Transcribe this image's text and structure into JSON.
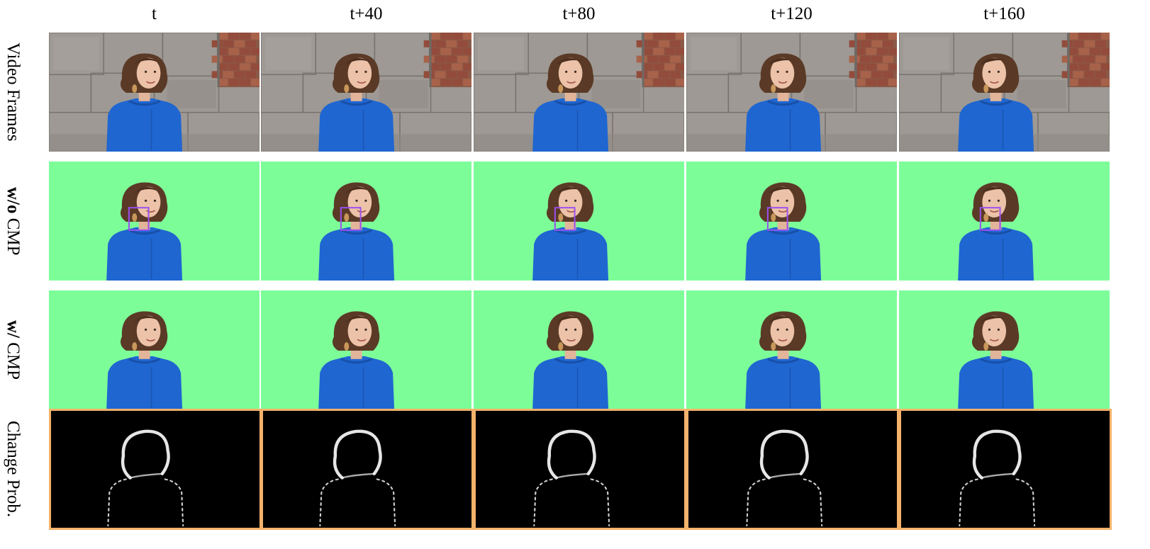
{
  "columns": [
    "t",
    "t+40",
    "t+80",
    "t+120",
    "t+160"
  ],
  "rows": [
    {
      "label_bold": "",
      "label_rest": "Video Frames",
      "kind": "frame"
    },
    {
      "label_bold": "w/o",
      "label_rest": " CMP",
      "kind": "matte-box"
    },
    {
      "label_bold": "w/",
      "label_rest": " CMP",
      "kind": "matte"
    },
    {
      "label_bold": "",
      "label_rest": "Change Prob.",
      "kind": "prob"
    }
  ],
  "colors": {
    "matte_background": "#7dfd98",
    "highlight_box": "#9b4ff0",
    "probability_frame": "#f4b26a",
    "sweater": "#1f66d1",
    "hair": "#5a3a26"
  }
}
